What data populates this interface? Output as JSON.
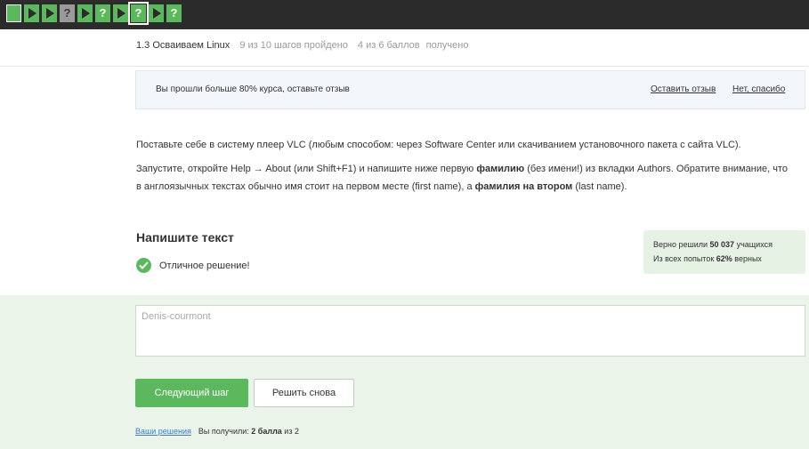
{
  "steps": [
    {
      "type": "lesson",
      "color": "green"
    },
    {
      "type": "play",
      "color": "green"
    },
    {
      "type": "play",
      "color": "green"
    },
    {
      "type": "question",
      "color": "gray",
      "label": "?"
    },
    {
      "type": "play",
      "color": "green"
    },
    {
      "type": "question",
      "color": "green",
      "label": "?"
    },
    {
      "type": "play",
      "color": "green"
    },
    {
      "type": "question",
      "color": "green",
      "label": "?",
      "current": true
    },
    {
      "type": "play",
      "color": "green"
    },
    {
      "type": "question",
      "color": "green",
      "label": "?"
    }
  ],
  "lesson": {
    "title": "1.3 Осваиваем Linux",
    "steps_progress": "9 из 10 шагов пройдено",
    "points_progress": "4 из 6 баллов",
    "points_suffix": "получено"
  },
  "feedback": {
    "message": "Вы прошли больше 80% курса, оставьте отзыв",
    "leave_label": "Оставить отзыв",
    "decline_label": "Нет, спасибо"
  },
  "content": {
    "p1": "Поставьте себе в систему плеер VLC (любым способом: через Software Center или скачиванием установочного пакета с сайта VLC).",
    "p2_a": "Запустите, откройте Help → About (или Shift+F1) и напишите ниже первую ",
    "p2_b": "фамилию",
    "p2_c": " (без имени!) из вкладки Authors. Обратите внимание, что в англоязычных текстах обычно имя стоит на первом месте (first name), а ",
    "p2_d": "фамилия на втором",
    "p2_e": " (last name)."
  },
  "task": {
    "title": "Напишите текст",
    "status": "Отличное решение!",
    "answer_value": "Denis-courmont"
  },
  "stats": {
    "line1_prefix": "Верно решили ",
    "line1_count": "50 037",
    "line1_suffix": " учащихся",
    "line2_prefix": "Из всех попыток ",
    "line2_percent": "62%",
    "line2_suffix": " верных"
  },
  "buttons": {
    "next": "Следующий шаг",
    "retry": "Решить снова"
  },
  "footer": {
    "your_solutions": "Ваши решения",
    "got_prefix": "Вы получили: ",
    "got_points": "2 балла",
    "got_suffix": " из 2"
  },
  "colors": {
    "accent": "#5cb85c",
    "topbar": "#2b2b2b",
    "link": "#3a7bd5"
  }
}
